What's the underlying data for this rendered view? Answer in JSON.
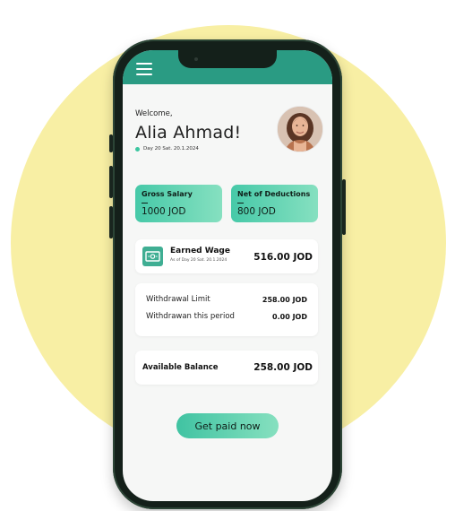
{
  "header": {
    "menu_icon": "hamburger-icon"
  },
  "greeting": {
    "welcome": "Welcome,",
    "name": "Alia Ahmad!",
    "date": "Day 20 Sat. 20.1.2024"
  },
  "summary": {
    "gross_salary_label": "Gross Salary",
    "gross_salary_value": "1000 JOD",
    "net_label": "Net of Deductions",
    "net_value": "800 JOD"
  },
  "earned_wage": {
    "icon": "cash-icon",
    "title": "Earned Wage",
    "subtitle": "As of Day 20 Sat. 20.1.2024",
    "value": "516.00 JOD"
  },
  "withdrawals": [
    {
      "label": "Withdrawal Limit",
      "value": "258.00 JOD"
    },
    {
      "label": "Withdrawan this period",
      "value": "0.00 JOD"
    }
  ],
  "balance": {
    "label": "Available Balance",
    "value": "258.00 JOD"
  },
  "cta": {
    "label": "Get paid now"
  },
  "colors": {
    "brand_green": "#2a9b83",
    "accent_mint": "#46c9a8",
    "background_circle": "#f8efa4",
    "phone_frame": "#14201a"
  }
}
